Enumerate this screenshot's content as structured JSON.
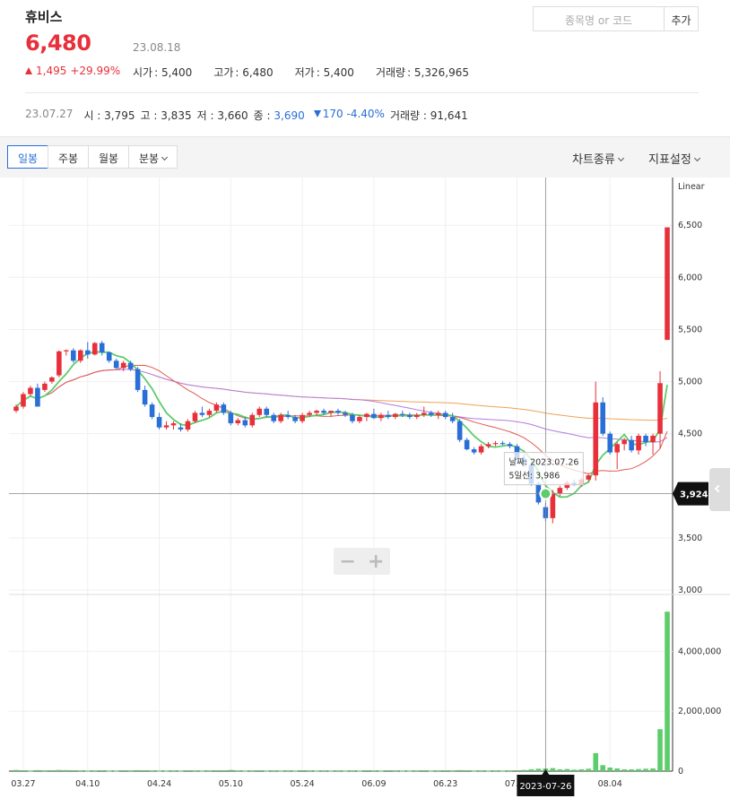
{
  "header": {
    "stock_name": "휴비스",
    "price": "6,480",
    "date": "23.08.18",
    "change": "1,495",
    "change_pct": "+29.99%",
    "stats": [
      {
        "label": "시가",
        "value": "5,400"
      },
      {
        "label": "고가",
        "value": "6,480"
      },
      {
        "label": "저가",
        "value": "5,400"
      },
      {
        "label": "거래량",
        "value": "5,326,965"
      }
    ]
  },
  "search": {
    "placeholder": "종목명 or 코드",
    "add_label": "추가"
  },
  "prev_day": {
    "date": "23.07.27",
    "open_label": "시",
    "open": "3,795",
    "high_label": "고",
    "high": "3,835",
    "low_label": "저",
    "low": "3,660",
    "close_label": "종",
    "close": "3,690",
    "change": "170",
    "change_pct": "-4.40%",
    "volume_label": "거래량",
    "volume": "91,641"
  },
  "toolbar": {
    "tabs": [
      "일봉",
      "주봉",
      "월봉",
      "분봉"
    ],
    "chart_type": "차트종류",
    "indicator": "지표설정"
  },
  "colors": {
    "up": "#e8303b",
    "down": "#2a6ed8",
    "ma5": "#5ccd6a",
    "ma20": "#e05a4e",
    "ma60": "#b57be0",
    "ma120": "#eea25a",
    "volume": "#5ccd6a"
  },
  "chart_data": {
    "type": "candlestick",
    "scale_label": "Linear",
    "price_ticks": [
      "6,500",
      "6,000",
      "5,500",
      "5,000",
      "4,500",
      "3,500",
      "3,000"
    ],
    "volume_ticks": [
      "4,000,000",
      "2,000,000",
      "0"
    ],
    "x_ticks": [
      "03.27",
      "04.10",
      "04.24",
      "05.10",
      "05.24",
      "06.09",
      "06.23",
      "07.07",
      "08.04"
    ],
    "crosshair": {
      "date": "2023-07-26",
      "price": "3,924",
      "tooltip_date": "날짜: 2023.07.26",
      "tooltip_ma5": "5일선: 3,986"
    },
    "ylim": [
      3000,
      6700
    ],
    "candles": [
      [
        4720,
        4780,
        4700,
        4760
      ],
      [
        4760,
        4900,
        4740,
        4880
      ],
      [
        4880,
        4960,
        4860,
        4940
      ],
      [
        4940,
        4980,
        4800,
        4760
      ],
      [
        4920,
        5000,
        4900,
        4980
      ],
      [
        5000,
        5050,
        4980,
        5040
      ],
      [
        5060,
        5300,
        5040,
        5290
      ],
      [
        5290,
        5310,
        5250,
        5300
      ],
      [
        5300,
        5320,
        5180,
        5200
      ],
      [
        5200,
        5310,
        5180,
        5300
      ],
      [
        5300,
        5380,
        5220,
        5260
      ],
      [
        5260,
        5380,
        5250,
        5370
      ],
      [
        5370,
        5390,
        5250,
        5280
      ],
      [
        5280,
        5290,
        5180,
        5200
      ],
      [
        5200,
        5220,
        5120,
        5130
      ],
      [
        5130,
        5200,
        5100,
        5180
      ],
      [
        5180,
        5200,
        5100,
        5120
      ],
      [
        5120,
        5140,
        4900,
        4920
      ],
      [
        4920,
        4960,
        4760,
        4780
      ],
      [
        4780,
        4800,
        4640,
        4660
      ],
      [
        4660,
        4700,
        4540,
        4560
      ],
      [
        4560,
        4620,
        4540,
        4580
      ],
      [
        4580,
        4620,
        4540,
        4600
      ],
      [
        4560,
        4600,
        4520,
        4540
      ],
      [
        4540,
        4640,
        4520,
        4620
      ],
      [
        4620,
        4720,
        4600,
        4700
      ],
      [
        4700,
        4760,
        4660,
        4680
      ],
      [
        4680,
        4740,
        4660,
        4720
      ],
      [
        4720,
        4800,
        4700,
        4780
      ],
      [
        4780,
        4800,
        4680,
        4700
      ],
      [
        4700,
        4720,
        4580,
        4600
      ],
      [
        4600,
        4650,
        4580,
        4630
      ],
      [
        4630,
        4660,
        4560,
        4580
      ],
      [
        4580,
        4700,
        4560,
        4680
      ],
      [
        4680,
        4760,
        4660,
        4740
      ],
      [
        4740,
        4760,
        4660,
        4680
      ],
      [
        4680,
        4700,
        4600,
        4620
      ],
      [
        4620,
        4700,
        4600,
        4680
      ],
      [
        4680,
        4720,
        4640,
        4660
      ],
      [
        4660,
        4680,
        4600,
        4620
      ],
      [
        4620,
        4700,
        4600,
        4680
      ],
      [
        4680,
        4720,
        4660,
        4700
      ],
      [
        4700,
        4730,
        4670,
        4720
      ],
      [
        4720,
        4740,
        4680,
        4700
      ],
      [
        4700,
        4720,
        4660,
        4720
      ],
      [
        4720,
        4740,
        4680,
        4700
      ],
      [
        4700,
        4720,
        4660,
        4680
      ],
      [
        4680,
        4700,
        4600,
        4620
      ],
      [
        4620,
        4680,
        4600,
        4660
      ],
      [
        4660,
        4700,
        4620,
        4690
      ],
      [
        4690,
        4740,
        4640,
        4650
      ],
      [
        4650,
        4700,
        4620,
        4680
      ],
      [
        4680,
        4720,
        4640,
        4660
      ],
      [
        4660,
        4700,
        4640,
        4690
      ],
      [
        4690,
        4720,
        4660,
        4680
      ],
      [
        4680,
        4700,
        4640,
        4660
      ],
      [
        4660,
        4700,
        4640,
        4680
      ],
      [
        4680,
        4760,
        4660,
        4700
      ],
      [
        4700,
        4720,
        4660,
        4680
      ],
      [
        4680,
        4720,
        4640,
        4700
      ],
      [
        4700,
        4720,
        4640,
        4660
      ],
      [
        4660,
        4700,
        4600,
        4620
      ],
      [
        4620,
        4640,
        4420,
        4440
      ],
      [
        4440,
        4460,
        4340,
        4350
      ],
      [
        4350,
        4370,
        4300,
        4320
      ],
      [
        4320,
        4400,
        4300,
        4380
      ],
      [
        4380,
        4420,
        4360,
        4400
      ],
      [
        4400,
        4430,
        4380,
        4410
      ],
      [
        4410,
        4430,
        4390,
        4400
      ],
      [
        4400,
        4420,
        4360,
        4380
      ],
      [
        4380,
        4400,
        4240,
        4260
      ],
      [
        4260,
        4300,
        4180,
        4200
      ],
      [
        4200,
        4220,
        4000,
        4020
      ],
      [
        4020,
        4040,
        3820,
        3840
      ],
      [
        3795,
        3835,
        3660,
        3690
      ],
      [
        3690,
        3960,
        3640,
        3930
      ],
      [
        3930,
        4000,
        3900,
        3980
      ],
      [
        3980,
        4050,
        3960,
        4030
      ],
      [
        4030,
        4060,
        4000,
        4010
      ],
      [
        4010,
        4080,
        3990,
        4060
      ],
      [
        4060,
        4120,
        4040,
        4100
      ],
      [
        4100,
        5000,
        4050,
        4800
      ],
      [
        4800,
        4850,
        4480,
        4500
      ],
      [
        4500,
        4520,
        4300,
        4320
      ],
      [
        4320,
        4420,
        4160,
        4400
      ],
      [
        4400,
        4460,
        4340,
        4440
      ],
      [
        4440,
        4480,
        4320,
        4340
      ],
      [
        4340,
        4500,
        4300,
        4480
      ],
      [
        4480,
        4500,
        4380,
        4420
      ],
      [
        4420,
        4500,
        4300,
        4480
      ],
      [
        4500,
        5100,
        4360,
        4985
      ],
      [
        5400,
        6480,
        5400,
        6480
      ]
    ],
    "volumes": [
      40,
      30,
      20,
      35,
      25,
      30,
      40,
      35,
      30,
      25,
      20,
      25,
      30,
      20,
      20,
      30,
      25,
      35,
      30,
      25,
      20,
      20,
      25,
      20,
      30,
      25,
      20,
      25,
      30,
      30,
      40,
      25,
      20,
      25,
      30,
      20,
      25,
      20,
      25,
      20,
      30,
      25,
      20,
      25,
      20,
      25,
      20,
      25,
      20,
      30,
      25,
      20,
      30,
      25,
      20,
      20,
      25,
      30,
      20,
      25,
      30,
      25,
      35,
      30,
      20,
      25,
      20,
      25,
      20,
      25,
      30,
      40,
      60,
      80,
      90,
      100,
      60,
      70,
      50,
      60,
      80,
      600,
      200,
      120,
      90,
      60,
      60,
      70,
      80,
      90,
      1400,
      5326
    ],
    "volume_max": 5600
  }
}
